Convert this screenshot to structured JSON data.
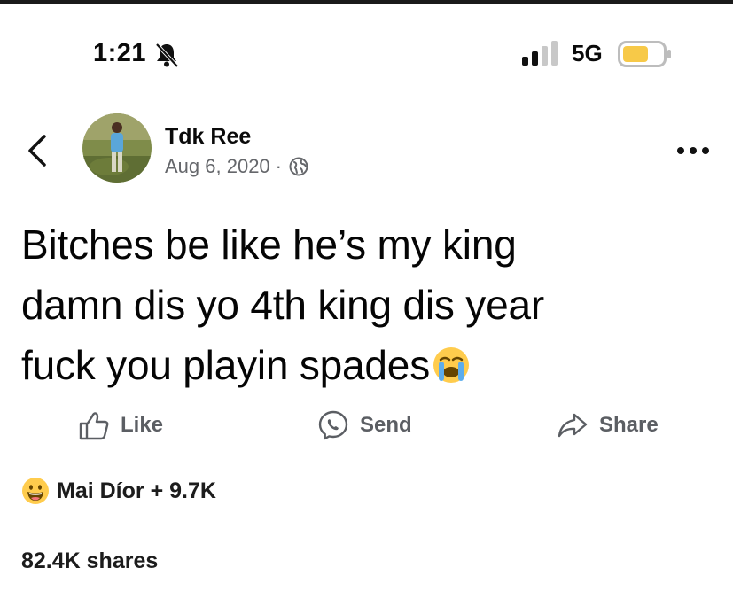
{
  "status_bar": {
    "time": "1:21",
    "network": "5G",
    "battery_color": "#f7c948",
    "icons": [
      "bell-muted-icon",
      "cellular-signal-icon",
      "battery-icon"
    ]
  },
  "post": {
    "author": "Tdk Ree",
    "date": "Aug 6, 2020",
    "separator": "·",
    "privacy_icon": "globe-icon",
    "text_lines": [
      "Bitches be like he’s my king",
      "damn dis yo 4th king dis year",
      "fuck you playin spades"
    ],
    "text_emoji": "loudly-crying-face-emoji"
  },
  "actions": {
    "like": "Like",
    "send": "Send",
    "share": "Share"
  },
  "reactions": {
    "emoji": "grinning-face-emoji",
    "summary": "Mai Díor + 9.7K"
  },
  "shares_count": "82.4K shares"
}
